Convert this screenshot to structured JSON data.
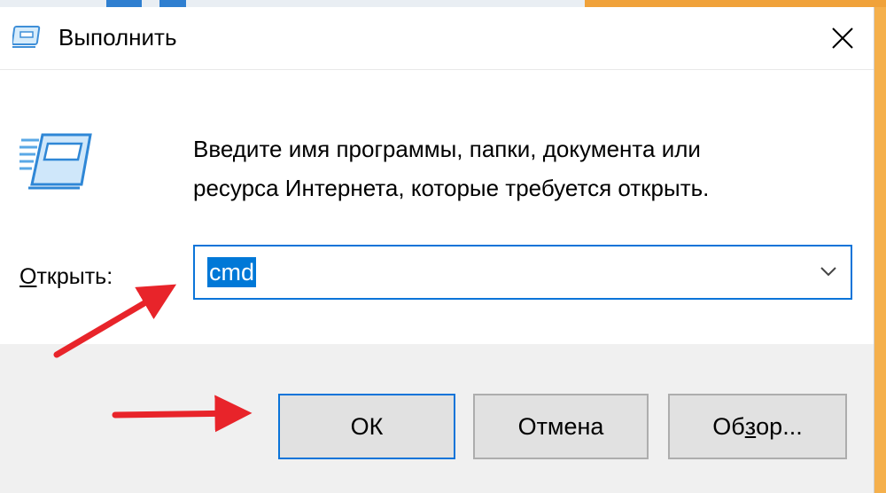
{
  "window": {
    "title": "Выполнить"
  },
  "content": {
    "description_line1": "Введите имя программы, папки, документа или",
    "description_line2": "ресурса Интернета, которые требуется открыть.",
    "open_label_first": "О",
    "open_label_rest": "ткрыть:",
    "open_value": "cmd"
  },
  "buttons": {
    "ok": "ОК",
    "cancel": "Отмена",
    "browse_pre": "Об",
    "browse_underlined": "з",
    "browse_post": "ор..."
  },
  "icons": {
    "title": "run-icon",
    "close": "close-icon",
    "big": "run-icon",
    "dropdown": "chevron-down-icon"
  },
  "colors": {
    "accent": "#0a74d9",
    "selection": "#0078d7",
    "annotation": "#e8242a",
    "panel": "#f0f0f0"
  }
}
